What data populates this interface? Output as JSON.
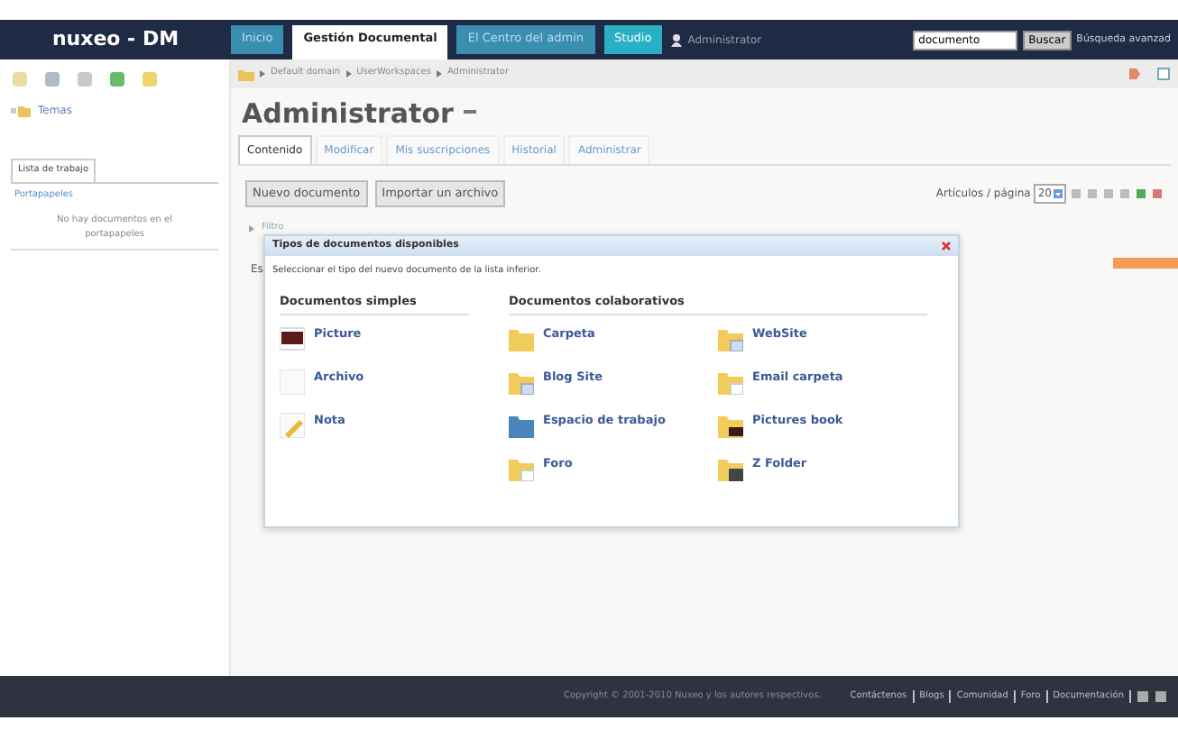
{
  "header": {
    "logo": "nuxeo - DM",
    "tabs": [
      {
        "label": "Inicio",
        "selected": false
      },
      {
        "label": "Gestión Documental",
        "selected": true
      },
      {
        "label": "El Centro del admin",
        "selected": false
      },
      {
        "label": "Studio",
        "selected": false
      }
    ],
    "user": "Administrator",
    "search": {
      "value": "documento",
      "button": "Buscar",
      "advanced": "Búsqueda avanzad"
    }
  },
  "sidebar": {
    "tree": [
      {
        "label": "Temas"
      }
    ],
    "worklist_tab": "Lista de trabajo",
    "clipboard": "Portapapeles",
    "empty": "No hay documentos en el portapapeles"
  },
  "breadcrumb": [
    "Default domain",
    "UserWorkspaces",
    "Administrator"
  ],
  "title": "Administrator",
  "tabs": [
    {
      "label": "Contenido",
      "selected": true
    },
    {
      "label": "Modificar",
      "selected": false
    },
    {
      "label": "Mis suscripciones",
      "selected": false
    },
    {
      "label": "Historial",
      "selected": false
    },
    {
      "label": "Administrar",
      "selected": false
    }
  ],
  "buttons": [
    "Nuevo documento",
    "Importar un archivo"
  ],
  "per_page": {
    "label": "Artículos / página",
    "value": "20"
  },
  "filter": "Filtro",
  "hidden_text": "Es",
  "dialog": {
    "title": "Tipos de documentos disponibles",
    "description": "Seleccionar el tipo del nuevo documento de la lista inferior.",
    "sections": [
      {
        "title": "Documentos simples",
        "columns": [
          [
            {
              "label": "Picture",
              "kind": "picture"
            },
            {
              "label": "Archivo",
              "kind": "file"
            },
            {
              "label": "Nota",
              "kind": "note"
            }
          ]
        ]
      },
      {
        "title": "Documentos colaborativos",
        "columns": [
          [
            {
              "label": "Carpeta",
              "kind": "folder"
            },
            {
              "label": "Blog Site",
              "kind": "site"
            },
            {
              "label": "Espacio de trabajo",
              "kind": "workspace"
            },
            {
              "label": "Foro",
              "kind": "mail"
            }
          ],
          [
            {
              "label": "WebSite",
              "kind": "site"
            },
            {
              "label": "Email carpeta",
              "kind": "mail"
            },
            {
              "label": "Pictures book",
              "kind": "pictures"
            },
            {
              "label": "Z Folder",
              "kind": "zip"
            }
          ]
        ]
      }
    ]
  },
  "footer": {
    "copyright": "Copyright © 2001-2010 Nuxeo y los autores respectivos.",
    "links": [
      "Contáctenos",
      "Blogs",
      "Comunidad",
      "Foro",
      "Documentación"
    ]
  }
}
